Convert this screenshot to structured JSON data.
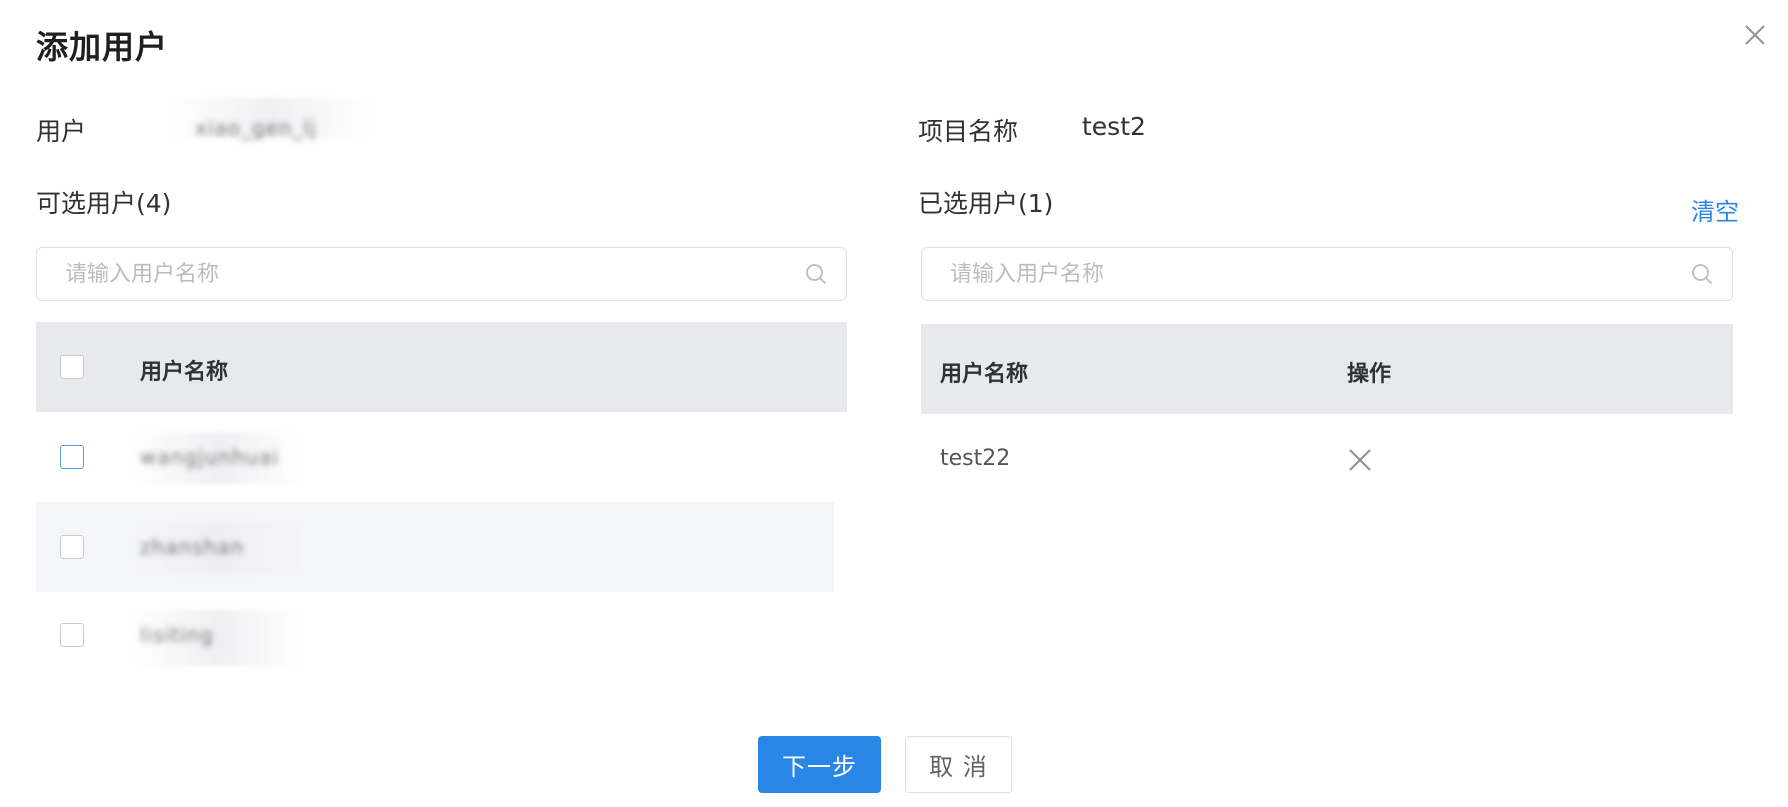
{
  "dialog": {
    "title": "添加用户"
  },
  "fields": {
    "user_label": "用户",
    "user_value": "xiao_gen_lj",
    "project_label": "项目名称",
    "project_value": "test2"
  },
  "available": {
    "title": "可选用户(4)",
    "search_placeholder": "请输入用户名称",
    "column_name": "用户名称",
    "rows": [
      {
        "name": "wangjunhuai"
      },
      {
        "name": "zhanshan"
      },
      {
        "name": "lisiting"
      }
    ]
  },
  "selected": {
    "title": "已选用户(1)",
    "clear_label": "清空",
    "search_placeholder": "请输入用户名称",
    "column_name": "用户名称",
    "column_action": "操作",
    "rows": [
      {
        "name": "test22"
      }
    ]
  },
  "footer": {
    "next_label": "下一步",
    "cancel_label": "取 消"
  },
  "colors": {
    "primary": "#2a86e6",
    "header_bg": "#e8e9ed",
    "stripe_bg": "#f5f6f9"
  }
}
